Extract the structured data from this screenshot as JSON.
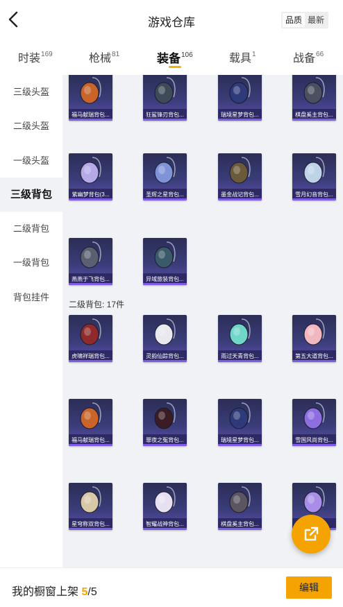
{
  "header": {
    "title": "游戏仓库",
    "sort_options": [
      "品质",
      "最新"
    ],
    "active_sort": "品质"
  },
  "tabs": [
    {
      "label": "时装",
      "count": "169"
    },
    {
      "label": "枪械",
      "count": "81"
    },
    {
      "label": "装备",
      "count": "106",
      "active": true
    },
    {
      "label": "载具",
      "count": "1"
    },
    {
      "label": "战备",
      "count": "66"
    }
  ],
  "sidebar": [
    {
      "label": "三级头盔"
    },
    {
      "label": "二级头盔"
    },
    {
      "label": "一级头盔"
    },
    {
      "label": "三级背包",
      "active": true
    },
    {
      "label": "二级背包"
    },
    {
      "label": "一级背包"
    },
    {
      "label": "背包挂件"
    }
  ],
  "grid_top": [
    {
      "name": "福马献瑞背包...",
      "icon": "orange-fox-backpack-icon"
    },
    {
      "name": "狂鲨锋刃背包...",
      "icon": "shark-backpack-icon"
    },
    {
      "name": "瑞境星梦背包...",
      "icon": "mirror-frame-backpack-icon"
    },
    {
      "name": "棋盘奚主背包...",
      "icon": "chess-knight-backpack-icon"
    },
    {
      "name": "紫幽梦背包(3...",
      "icon": "purple-crystal-backpack-icon"
    },
    {
      "name": "圣辉之星背包...",
      "icon": "star-emblem-backpack-icon"
    },
    {
      "name": "墨金战记背包...",
      "icon": "gold-book-backpack-icon"
    },
    {
      "name": "雪月幻音背包...",
      "icon": "snow-moon-backpack-icon"
    },
    {
      "name": "燕燕于飞背包...",
      "icon": "swallow-backpack-icon"
    },
    {
      "name": "异域旅装背包...",
      "icon": "camera-backpack-icon"
    }
  ],
  "section_level2": {
    "label": "二级背包: 17件"
  },
  "grid_level2": [
    {
      "name": "虎啸祥瑞背包...",
      "icon": "red-tiger-backpack-icon"
    },
    {
      "name": "灵韵仙踪背包...",
      "icon": "white-flower-backpack-icon"
    },
    {
      "name": "雨过天青背包...",
      "icon": "teal-pouch-backpack-icon"
    },
    {
      "name": "第五大道背包...",
      "icon": "pink-handbag-backpack-icon"
    },
    {
      "name": "福马献瑞背包...",
      "icon": "orange-fox-backpack-icon"
    },
    {
      "name": "罪夜之冤背包...",
      "icon": "dark-mask-backpack-icon"
    },
    {
      "name": "瑞境星梦背包...",
      "icon": "mirror-frame-backpack-icon"
    },
    {
      "name": "雪国风尚背包...",
      "icon": "purple-creature-backpack-icon"
    },
    {
      "name": "星穹称双背包...",
      "icon": "bunny-box-backpack-icon"
    },
    {
      "name": "智耀战神背包...",
      "icon": "white-helmet-backpack-icon"
    },
    {
      "name": "棋盘奚主背包...",
      "icon": "chess-heart-backpack-icon"
    },
    {
      "name": "",
      "icon": "purple-bunny-backpack-icon"
    }
  ],
  "footer": {
    "label": "我的橱窗上架",
    "current": "5",
    "separator": "/5",
    "edit_label": "编辑"
  },
  "colors": {
    "accent": "#f5a300",
    "card_top": "#2b2e56",
    "card_bottom": "#5a4fb0",
    "content_bg": "#f0f2f5"
  }
}
